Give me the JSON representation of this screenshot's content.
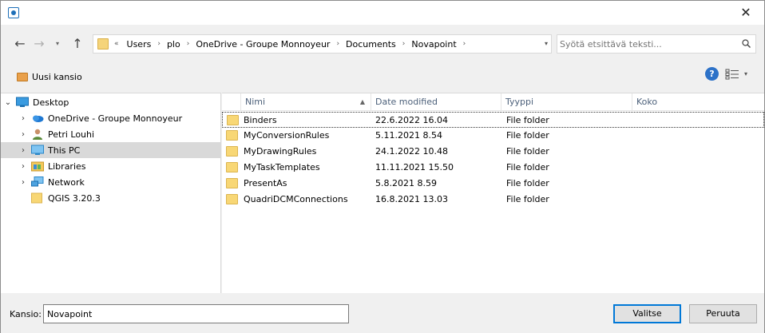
{
  "titlebar": {
    "close_glyph": "✕",
    "app_icon": "app-icon"
  },
  "nav": {
    "back_glyph": "←",
    "forward_glyph": "→",
    "recent_glyph": "▾",
    "up_glyph": "↑"
  },
  "address": {
    "lead": "«",
    "crumbs": [
      "Users",
      "plo",
      "OneDrive - Groupe Monnoyeur",
      "Documents",
      "Novapoint"
    ],
    "sep": "›",
    "drop": "▾"
  },
  "search": {
    "placeholder": "Syötä etsittävä teksti..."
  },
  "toolbar": {
    "new_folder_label": "Uusi kansio",
    "help_glyph": "?",
    "view_drop": "▾"
  },
  "tree": {
    "items": [
      {
        "label": "Desktop",
        "icon": "desktop-icon",
        "arrow": "⌄",
        "level": 0
      },
      {
        "label": "OneDrive - Groupe Monnoyeur",
        "icon": "onedrive-icon",
        "arrow": "›",
        "level": 1
      },
      {
        "label": "Petri Louhi",
        "icon": "user-icon",
        "arrow": "›",
        "level": 1
      },
      {
        "label": "This PC",
        "icon": "computer-icon",
        "arrow": "›",
        "level": 1,
        "selected": true
      },
      {
        "label": "Libraries",
        "icon": "libraries-icon",
        "arrow": "›",
        "level": 1
      },
      {
        "label": "Network",
        "icon": "network-icon",
        "arrow": "›",
        "level": 1
      },
      {
        "label": "QGIS 3.20.3",
        "icon": "folder-icon",
        "arrow": "",
        "level": 1
      }
    ]
  },
  "files": {
    "columns": {
      "name": "Nimi",
      "date": "Date modified",
      "type": "Tyyppi",
      "size": "Koko"
    },
    "sort_glyph": "▲",
    "rows": [
      {
        "name": "Binders",
        "date": "22.6.2022 16.04",
        "type": "File folder",
        "size": ""
      },
      {
        "name": "MyConversionRules",
        "date": "5.11.2021 8.54",
        "type": "File folder",
        "size": ""
      },
      {
        "name": "MyDrawingRules",
        "date": "24.1.2022 10.48",
        "type": "File folder",
        "size": ""
      },
      {
        "name": "MyTaskTemplates",
        "date": "11.11.2021 15.50",
        "type": "File folder",
        "size": ""
      },
      {
        "name": "PresentAs",
        "date": "5.8.2021 8.59",
        "type": "File folder",
        "size": ""
      },
      {
        "name": "QuadriDCMConnections",
        "date": "16.8.2021 13.03",
        "type": "File folder",
        "size": ""
      }
    ]
  },
  "bottom": {
    "folder_label": "Kansio:",
    "folder_value": "Novapoint",
    "ok_label": "Valitse",
    "cancel_label": "Peruuta"
  },
  "colors": {
    "accent": "#0078d7",
    "selection": "#d9d9d9",
    "folder": "#f8d775",
    "help": "#2d72c8"
  }
}
